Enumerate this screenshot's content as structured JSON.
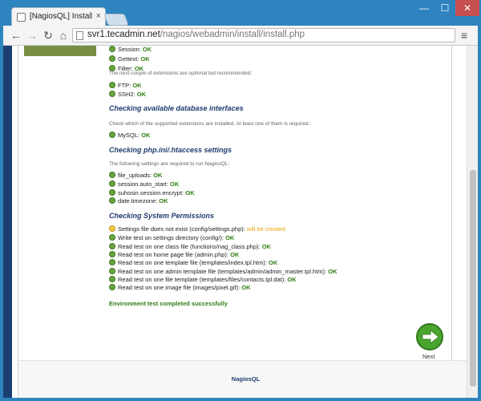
{
  "browser": {
    "tab_title": "[NagiosQL] Installation W...",
    "close_glyph": "×",
    "minimize_glyph": "—",
    "maximize_glyph": "☐",
    "close_window_glyph": "✕",
    "back_glyph": "←",
    "forward_glyph": "→",
    "reload_glyph": "↻",
    "home_glyph": "⌂",
    "menu_glyph": "≡",
    "url_host": "svr1.tecadmin.net",
    "url_path": "/nagios/webadmin/install/install.php"
  },
  "page": {
    "basic_extensions": [
      {
        "label": "Session:",
        "status": "OK"
      },
      {
        "label": "Gettext:",
        "status": "OK"
      },
      {
        "label": "Filter:",
        "status": "OK"
      }
    ],
    "optional_note_prefix": "The next couple of extensions are ",
    "optional_note_em": "optional",
    "optional_note_suffix": " but recommended:",
    "optional_extensions": [
      {
        "label": "FTP:",
        "status": "OK"
      },
      {
        "label": "SSH2:",
        "status": "OK"
      }
    ],
    "db_heading": "Checking available database interfaces",
    "db_note": "Check which of the supported extensions are installed. At least one of them is required.:",
    "db_items": [
      {
        "label": "MySQL:",
        "status": "OK"
      }
    ],
    "php_heading": "Checking php.ini/.htaccess settings",
    "php_note": "The following settings are required to run NagiosQL:",
    "php_items": [
      {
        "label": "file_uploads:",
        "status": "OK"
      },
      {
        "label": "session.auto_start:",
        "status": "OK"
      },
      {
        "label": "suhosin.session.encrypt:",
        "status": "OK"
      },
      {
        "label": "date.timezone:",
        "status": "OK"
      }
    ],
    "perm_heading": "Checking System Permissions",
    "perm_warning": {
      "label": "Settings file does not exist (config/settings.php):",
      "status": "will be created"
    },
    "perm_items": [
      {
        "label": "Write test on settings directory (config/):",
        "status": "OK"
      },
      {
        "label": "Read test on one class file (functions/nag_class.php):",
        "status": "OK"
      },
      {
        "label": "Read test on home page file (admin.php):",
        "status": "OK"
      },
      {
        "label": "Read test on one template file (templates/index.tpl.htm):",
        "status": "OK"
      },
      {
        "label": "Read test on one admin template file (templates/admin/admin_master.tpl.htm):",
        "status": "OK"
      },
      {
        "label": "Read test on one file template (templates/files/contacts.tpl.dat):",
        "status": "OK"
      },
      {
        "label": "Read test on one image file (images/pixel.gif):",
        "status": "OK"
      }
    ],
    "success_text": "Environment test completed successfully",
    "next_label": "Next",
    "footer_text": "NagiosQL"
  },
  "icons": {
    "ok": "green-check-circle",
    "warning": "yellow-circle",
    "next": "green-arrow-circle"
  },
  "colors": {
    "ok": "#2e7d12",
    "warning": "#e8a50c",
    "heading": "#1e3c6e",
    "frame": "#2e84bf"
  }
}
